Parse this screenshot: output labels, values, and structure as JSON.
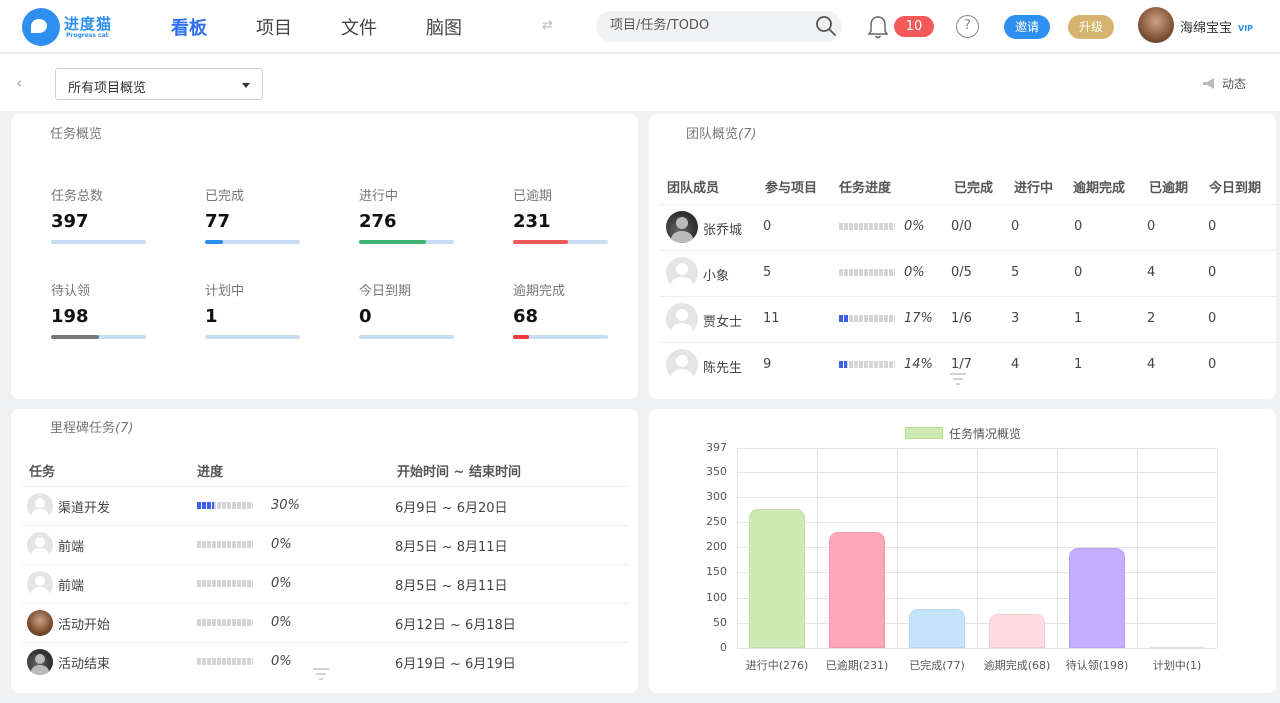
{
  "header": {
    "brand": "进度猫",
    "brand_sub": "Progress cat",
    "nav": [
      "看板",
      "项目",
      "文件",
      "脑图"
    ],
    "search_placeholder": "项目/任务/TODO",
    "notification_count": "10",
    "help": "?",
    "invite_label": "邀请",
    "upgrade_label": "升级",
    "user_name": "海绵宝宝",
    "vip": "VIP"
  },
  "toolbar": {
    "back": "‹",
    "project_select": "所有项目概览",
    "activity_label": "动态"
  },
  "task_overview": {
    "title": "任务概览",
    "stats": [
      {
        "label": "任务总数",
        "value": "397",
        "progress": 0.0,
        "color": "#2f8ff0"
      },
      {
        "label": "已完成",
        "value": "77",
        "progress": 0.19,
        "color": "#2f8ff0"
      },
      {
        "label": "进行中",
        "value": "276",
        "progress": 0.7,
        "color": "#3cb371"
      },
      {
        "label": "已逾期",
        "value": "231",
        "progress": 0.58,
        "color": "#ef5b5b"
      },
      {
        "label": "待认领",
        "value": "198",
        "progress": 0.5,
        "color": "#777777"
      },
      {
        "label": "计划中",
        "value": "1",
        "progress": 0.0,
        "color": "#2f8ff0"
      },
      {
        "label": "今日到期",
        "value": "0",
        "progress": 0.0,
        "color": "#2f8ff0"
      },
      {
        "label": "逾期完成",
        "value": "68",
        "progress": 0.17,
        "color": "#ef3b3b"
      }
    ]
  },
  "team_overview": {
    "title": "团队概览",
    "count": "(7)",
    "columns": [
      "团队成员",
      "参与项目",
      "任务进度",
      "已完成",
      "进行中",
      "逾期完成",
      "已逾期",
      "今日到期"
    ],
    "rows": [
      {
        "name": "张乔城",
        "projects": "0",
        "progress": 0.0,
        "pct": "0%",
        "done": "0/0",
        "doing": "0",
        "late_done": "0",
        "overdue": "0",
        "due_today": "0",
        "avatar": "dark"
      },
      {
        "name": "小象",
        "projects": "5",
        "progress": 0.0,
        "pct": "0%",
        "done": "0/5",
        "doing": "5",
        "late_done": "0",
        "overdue": "4",
        "due_today": "0",
        "avatar": "default"
      },
      {
        "name": "贾女士",
        "projects": "11",
        "progress": 0.17,
        "pct": "17%",
        "done": "1/6",
        "doing": "3",
        "late_done": "1",
        "overdue": "2",
        "due_today": "0",
        "avatar": "default"
      },
      {
        "name": "陈先生",
        "projects": "9",
        "progress": 0.14,
        "pct": "14%",
        "done": "1/7",
        "doing": "4",
        "late_done": "1",
        "overdue": "4",
        "due_today": "0",
        "avatar": "default"
      }
    ]
  },
  "milestones": {
    "title": "里程碑任务",
    "count": "(7)",
    "columns": [
      "任务",
      "进度",
      "开始时间 ~ 结束时间"
    ],
    "rows": [
      {
        "name": "渠道开发",
        "progress": 0.3,
        "pct": "30%",
        "range": "6月9日 ~ 6月20日",
        "avatar": "default"
      },
      {
        "name": "前端",
        "progress": 0.0,
        "pct": "0%",
        "range": "8月5日 ~ 8月11日",
        "avatar": "default"
      },
      {
        "name": "前端",
        "progress": 0.0,
        "pct": "0%",
        "range": "8月5日 ~ 8月11日",
        "avatar": "default"
      },
      {
        "name": "活动开始",
        "progress": 0.0,
        "pct": "0%",
        "range": "6月12日 ~ 6月18日",
        "avatar": "photo"
      },
      {
        "name": "活动结束",
        "progress": 0.0,
        "pct": "0%",
        "range": "6月19日 ~ 6月19日",
        "avatar": "dark"
      }
    ]
  },
  "chart_data": {
    "type": "bar",
    "title": "",
    "legend": "任务情况概览",
    "legend_position": "top",
    "categories": [
      "进行中(276)",
      "已逾期(231)",
      "已完成(77)",
      "逾期完成(68)",
      "待认领(198)",
      "计划中(1)"
    ],
    "values": [
      276,
      231,
      77,
      68,
      198,
      1
    ],
    "colors": [
      "#cdeab5",
      "#ffa6b9",
      "#c4e4fb",
      "#ffdce1",
      "#c6adff",
      "#ececec"
    ],
    "ylim": [
      0,
      397
    ],
    "yticks": [
      "0",
      "50",
      "100",
      "150",
      "200",
      "250",
      "300",
      "350",
      "397"
    ],
    "grid": true
  }
}
